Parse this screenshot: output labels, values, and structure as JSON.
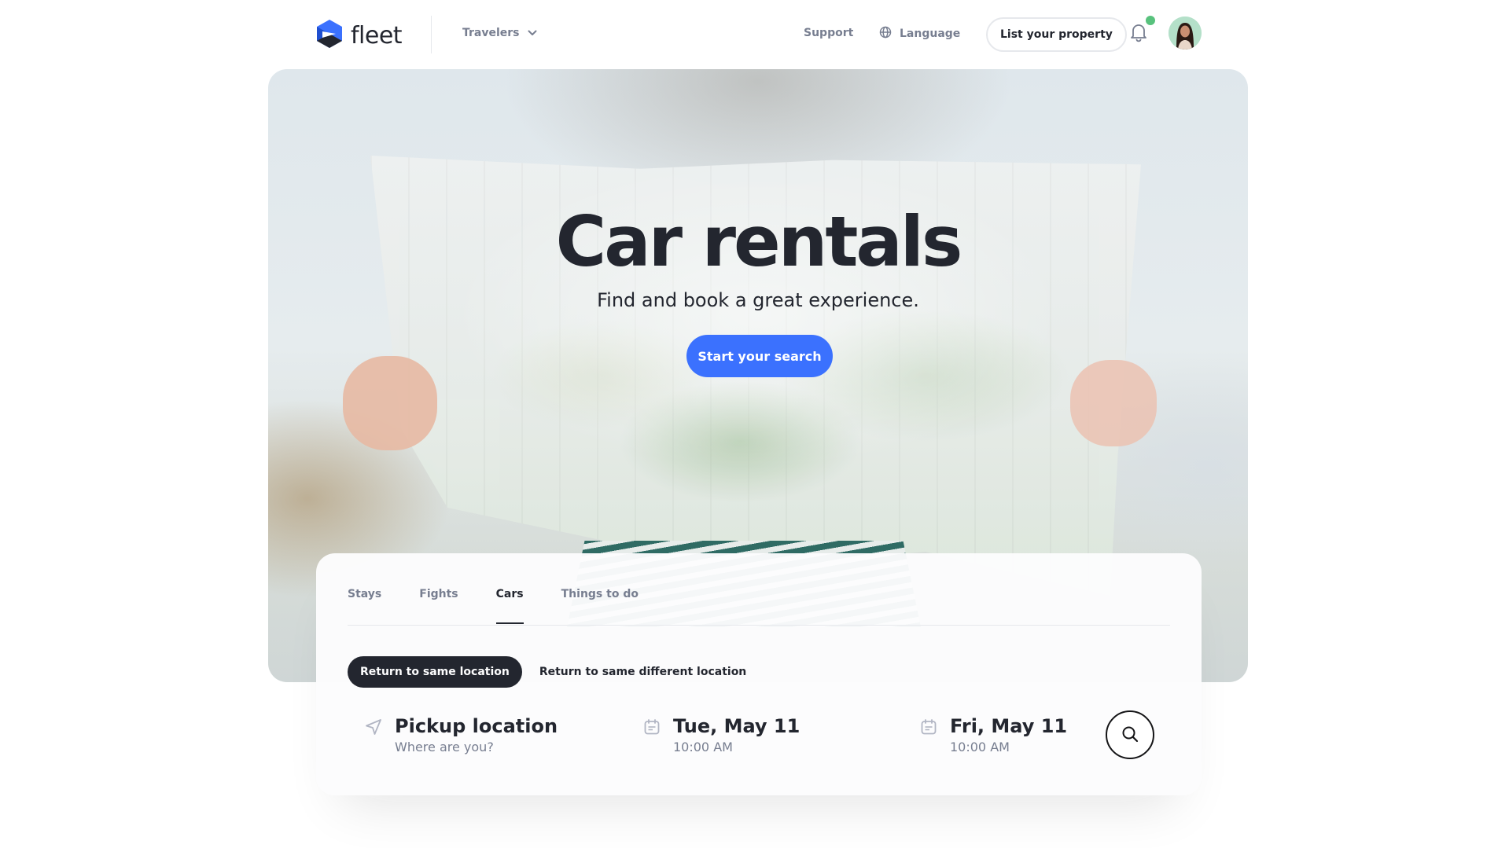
{
  "header": {
    "logo_text": "fleet",
    "travelers_label": "Travelers",
    "support_label": "Support",
    "language_label": "Language",
    "list_property_label": "List your property"
  },
  "hero": {
    "title": "Car rentals",
    "subtitle": "Find and book a great experience.",
    "cta_label": "Start your search"
  },
  "search": {
    "tabs": [
      {
        "label": "Stays",
        "active": false
      },
      {
        "label": "Fights",
        "active": false
      },
      {
        "label": "Cars",
        "active": true
      },
      {
        "label": "Things to do",
        "active": false
      }
    ],
    "return_options": [
      {
        "label": "Return to same location",
        "active": true
      },
      {
        "label": "Return to same different location",
        "active": false
      }
    ],
    "pickup": {
      "main": "Pickup location",
      "sub": "Where are you?"
    },
    "start_date": {
      "main": "Tue, May 11",
      "sub": "10:00 AM"
    },
    "end_date": {
      "main": "Fri, May 11",
      "sub": "10:00 AM"
    }
  },
  "colors": {
    "accent": "#3b71fe",
    "dark": "#23262f",
    "muted": "#777e90",
    "notification": "#58c27d"
  },
  "icons": {
    "logo": "fleet-logo-icon",
    "travelers_chevron": "chevron-down-icon",
    "language": "globe-icon",
    "notifications": "bell-icon",
    "pickup": "navigation-arrow-icon",
    "dates": "calendar-icon",
    "search": "search-icon"
  }
}
